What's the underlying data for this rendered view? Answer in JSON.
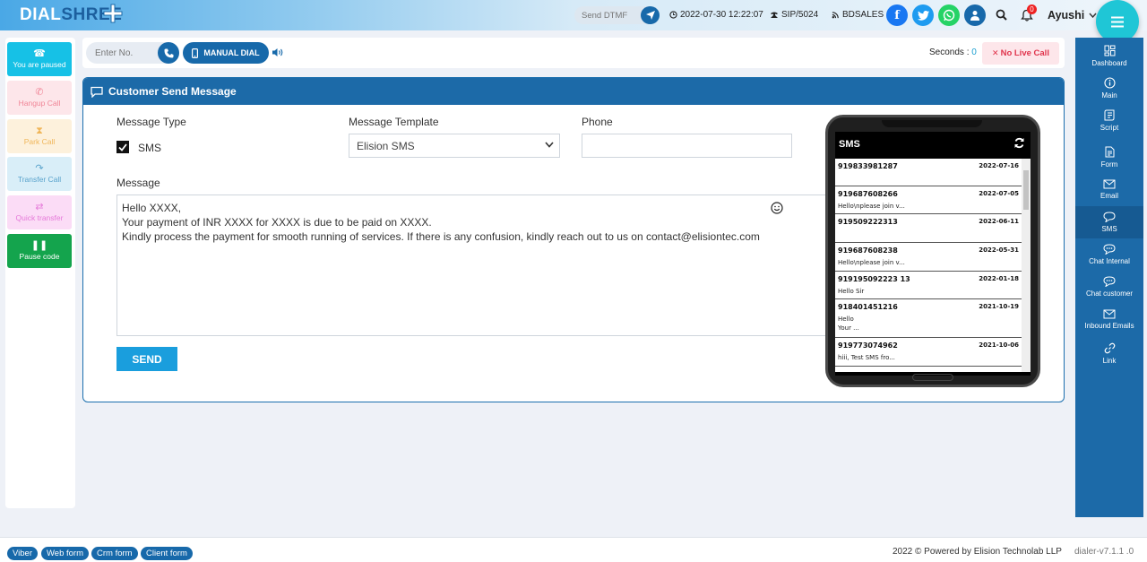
{
  "header": {
    "logo_part1": "DIAL",
    "logo_part2": "SHREE",
    "dtmf_placeholder": "Send DTMF",
    "datetime": "2022-07-30 12:22:07",
    "sip": "SIP/5024",
    "campaign": "BDSALES",
    "notification_count": "0",
    "username": "Ayushi"
  },
  "left_panel": {
    "paused": "You are paused",
    "hangup": "Hangup Call",
    "park": "Park Call",
    "transfer": "Transfer Call",
    "quick_transfer": "Quick transfer",
    "pause_code": "Pause code"
  },
  "dial_bar": {
    "enter_placeholder": "Enter No.",
    "manual_dial": "MANUAL DIAL",
    "seconds_label": "Seconds :",
    "seconds_value": "0",
    "no_live_call": "No Live Call"
  },
  "form": {
    "title": "Customer Send Message",
    "message_type_label": "Message Type",
    "sms_label": "SMS",
    "template_label": "Message Template",
    "template_value": "Elision SMS",
    "phone_label": "Phone",
    "phone_value": "",
    "message_label": "Message",
    "message_lines": [
      "Hello XXXX,",
      "Your payment of INR XXXX for XXXX is due to be paid on XXXX.",
      "Kindly process the payment for smooth running of services. If there is any confusion, kindly reach out to us on contact@elisiontec.com"
    ],
    "send": "SEND"
  },
  "sms_history": {
    "title": "SMS",
    "items": [
      {
        "number": "919833981287",
        "date": "2022-07-16",
        "preview": ""
      },
      {
        "number": "919687608266",
        "date": "2022-07-05",
        "preview": "Hello\\nplease join v..."
      },
      {
        "number": "919509222313",
        "date": "2022-06-11",
        "preview": ""
      },
      {
        "number": "919687608238",
        "date": "2022-05-31",
        "preview": "Hello\\nplease join v..."
      },
      {
        "number": "919195092223 13",
        "date": "2022-01-18",
        "preview": "Hello Sir"
      },
      {
        "number": "918401451216",
        "date": "2021-10-19",
        "preview": "Hello\nYour ..."
      },
      {
        "number": "919773074962",
        "date": "2021-10-06",
        "preview": "hiii, Test SMS fro..."
      }
    ]
  },
  "right_nav": {
    "dashboard": "Dashboard",
    "main": "Main",
    "script": "Script",
    "form": "Form",
    "email": "Email",
    "sms": "SMS",
    "chat_internal": "Chat Internal",
    "chat_customer": "Chat customer",
    "inbound_emails": "Inbound Emails",
    "link": "Link"
  },
  "footer": {
    "viber": "Viber",
    "web_form": "Web form",
    "crm_form": "Crm form",
    "client_form": "Client form",
    "copyright": "2022 © Powered by Elision Technolab LLP",
    "version": "dialer-v7.1.1 .0"
  },
  "colors": {
    "primary": "#1c6aa8",
    "accent": "#1fc6d6",
    "send": "#1a9edd",
    "no_live": "#e0344c"
  }
}
